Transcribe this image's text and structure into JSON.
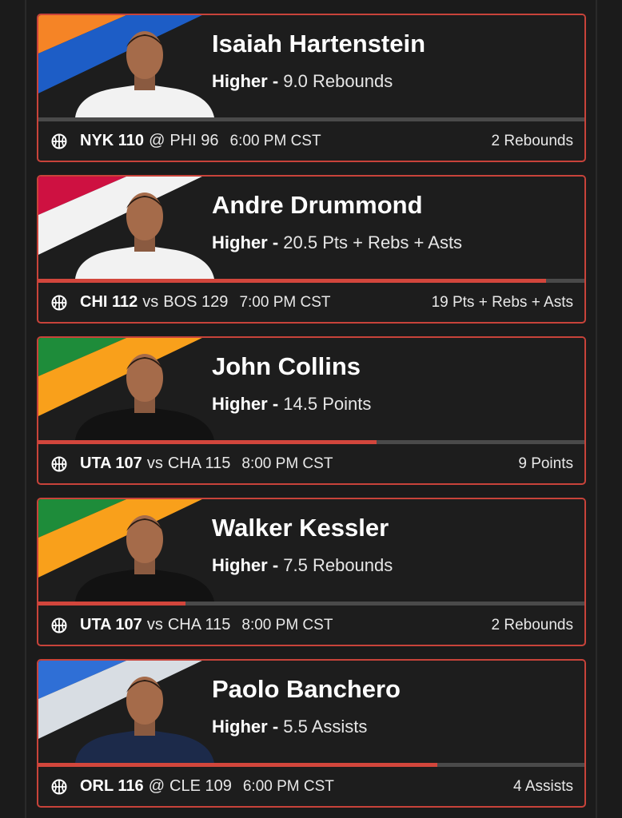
{
  "cards": [
    {
      "player": "Isaiah Hartenstein",
      "direction": "Higher",
      "separator": "-",
      "line": "9.0 Rebounds",
      "team_a": "NYK 110",
      "connector": "@",
      "team_b": "PHI 96",
      "time": "6:00 PM CST",
      "result": "2 Rebounds",
      "progress": 0.0,
      "stripe_colors": [
        "#f58426",
        "#1d5dc6",
        "#2a2a2a"
      ],
      "jersey": "#f2f2f2"
    },
    {
      "player": "Andre Drummond",
      "direction": "Higher",
      "separator": "-",
      "line": "20.5 Pts + Rebs + Asts",
      "team_a": "CHI 112",
      "connector": "vs",
      "team_b": "BOS 129",
      "time": "7:00 PM CST",
      "result": "19 Pts + Rebs + Asts",
      "progress": 0.93,
      "stripe_colors": [
        "#ce1141",
        "#f2f2f2",
        "#2a2a2a"
      ],
      "jersey": "#f2f2f2"
    },
    {
      "player": "John Collins",
      "direction": "Higher",
      "separator": "-",
      "line": "14.5 Points",
      "team_a": "UTA 107",
      "connector": "vs",
      "team_b": "CHA 115",
      "time": "8:00 PM CST",
      "result": "9 Points",
      "progress": 0.62,
      "stripe_colors": [
        "#1e8c3a",
        "#f9a01b",
        "#2a2a2a"
      ],
      "jersey": "#121212"
    },
    {
      "player": "Walker Kessler",
      "direction": "Higher",
      "separator": "-",
      "line": "7.5 Rebounds",
      "team_a": "UTA 107",
      "connector": "vs",
      "team_b": "CHA 115",
      "time": "8:00 PM CST",
      "result": "2 Rebounds",
      "progress": 0.27,
      "stripe_colors": [
        "#1e8c3a",
        "#f9a01b",
        "#2a2a2a"
      ],
      "jersey": "#121212"
    },
    {
      "player": "Paolo Banchero",
      "direction": "Higher",
      "separator": "-",
      "line": "5.5 Assists",
      "team_a": "ORL 116",
      "connector": "@",
      "team_b": "CLE 109",
      "time": "6:00 PM CST",
      "result": "4 Assists",
      "progress": 0.73,
      "stripe_colors": [
        "#2f6fd6",
        "#d8dde3",
        "#2a2a2a"
      ],
      "jersey": "#1c2a4a"
    }
  ],
  "colors": {
    "card_border": "#c8433a",
    "progress_fill": "#d2463c",
    "progress_track": "#4a4a4a",
    "background": "#1b1b1b"
  },
  "icons": {
    "sport": "basketball-icon"
  }
}
